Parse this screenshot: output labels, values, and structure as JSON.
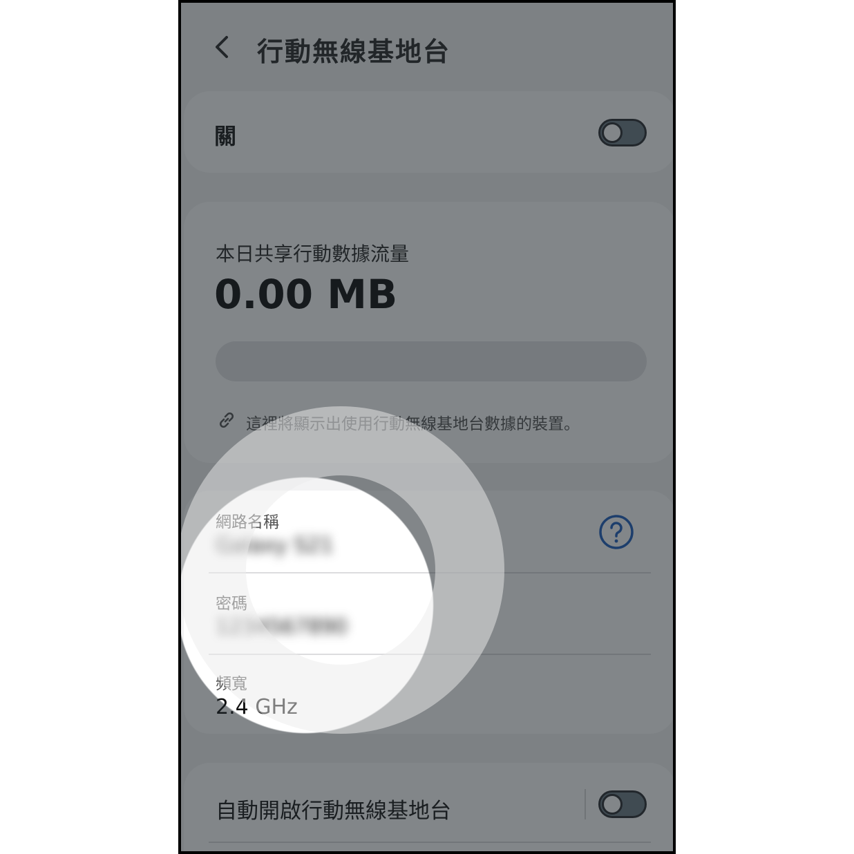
{
  "header": {
    "title": "行動無線基地台",
    "back_icon": "chevron-left-icon"
  },
  "hotspot_toggle": {
    "label": "關",
    "state": "off"
  },
  "usage": {
    "label": "本日共享行動數據流量",
    "value": "0.00 MB",
    "progress": 0,
    "note": "這裡將顯示出使用行動無線基地台數據的裝置。",
    "note_icon": "link-icon"
  },
  "network": {
    "name_label": "網路名稱",
    "name_value": "Galaxy S21",
    "password_label": "密碼",
    "password_value": "1234567890",
    "band_label": "頻寬",
    "band_value": "2.4 GHz",
    "help_icon": "question-circle-icon"
  },
  "auto_hotspot": {
    "label": "自動開啟行動無線基地台",
    "state": "off"
  },
  "colors": {
    "accent": "#1f5fbf",
    "overlay": "#1b2328",
    "card": "#ffffff",
    "background": "#f3f3f4"
  }
}
